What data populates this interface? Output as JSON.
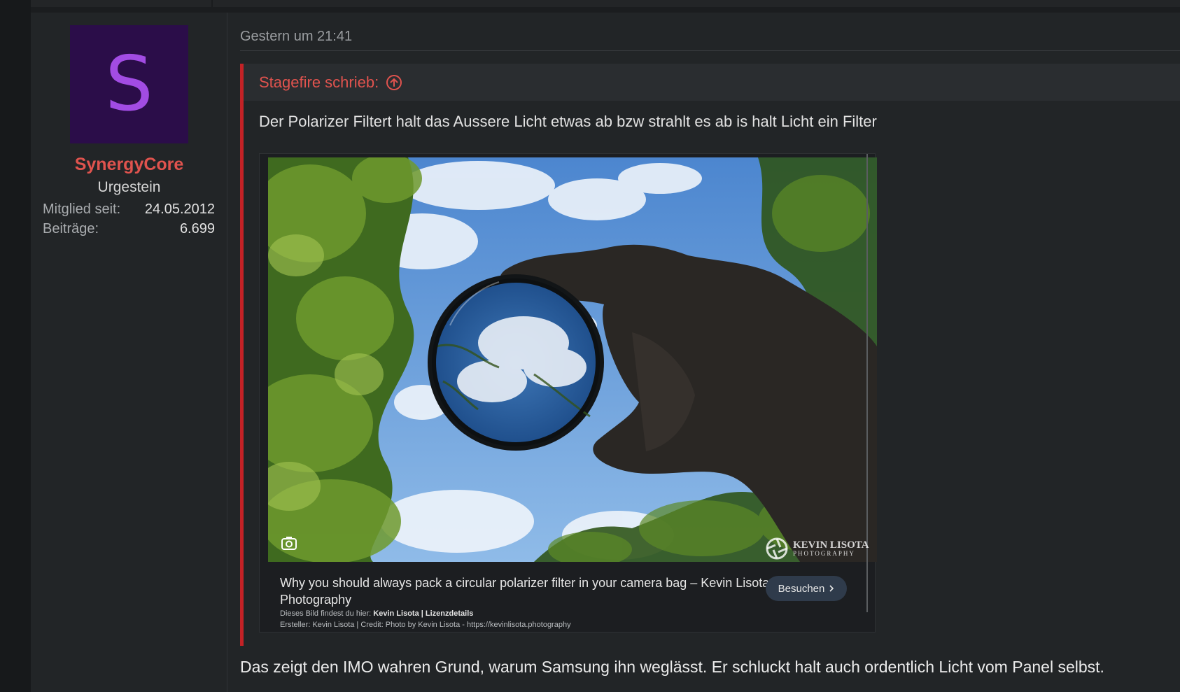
{
  "post": {
    "timestamp": "Gestern um 21:41"
  },
  "user": {
    "avatar_letter": "S",
    "name": "SynergyCore",
    "title": "Urgestein",
    "stats": [
      {
        "label": "Mitglied seit:",
        "value": "24.05.2012"
      },
      {
        "label": "Beiträge:",
        "value": "6.699"
      }
    ],
    "colors": {
      "name": "#e0534e",
      "avatar_bg": "#2b0d49",
      "avatar_letter": "#a24ce3"
    }
  },
  "quote": {
    "author": "Stagefire schrieb:",
    "author_icon": "arrow-up-circle-icon",
    "text": "Der Polarizer Filtert halt das Aussere Licht etwas ab bzw strahlt es ab is halt Licht ein Filter",
    "accent": "#c32226"
  },
  "embed": {
    "image_alt": "Hand holding a circular polarizer filter against a blue sky with clouds and trees",
    "lens_icon": "camera-search-icon",
    "watermark": {
      "line1": "KEVIN LISOTA",
      "line2": "PHOTOGRAPHY"
    },
    "caption": "Why you should always pack a circular polarizer filter in your camera bag – Kevin Lisota Photography",
    "visit_label": "Besuchen",
    "source_prefix": "Dieses Bild findest du hier:",
    "source_author": "Kevin Lisota",
    "source_sep": "|",
    "source_license": "Lizenzdetails",
    "credit": "Ersteller: Kevin Lisota | Credit: Photo by Kevin Lisota - https://kevinlisota.photography"
  },
  "reply": {
    "text": "Das zeigt den IMO wahren Grund, warum Samsung ihn weglässt. Er schluckt halt auch ordentlich Licht vom Panel selbst."
  }
}
